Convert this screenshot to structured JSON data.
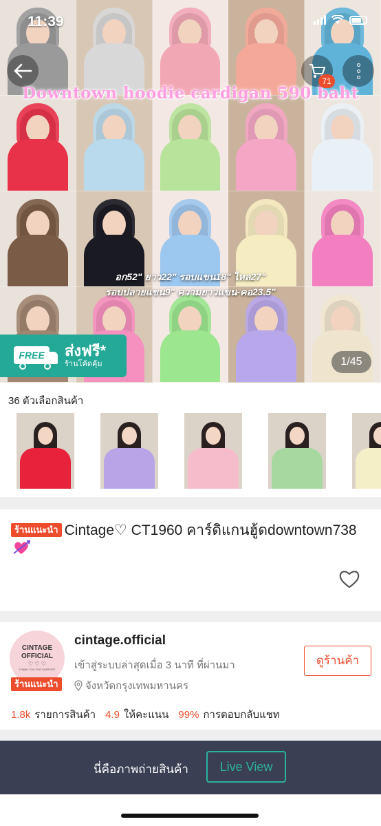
{
  "status_bar": {
    "time": "11:39"
  },
  "hero": {
    "promo_title": "Downtown hoodie cardigan 590 baht",
    "measure_line1": "อก52\" ยาว22\" รอบแขน18\" ไหล27\"",
    "measure_line2": "รอบปลายแขน9\" ความยาวแขน-คอ23.5\"",
    "free_shipping_badge": "FREE",
    "free_shipping_main": "ส่งฟรี*",
    "free_shipping_sub": "ร้านโค้ดคุ้ม",
    "image_counter": "1/45",
    "cart_count": "71",
    "tile_colors": [
      "#9a9a9a",
      "#d8d8d8",
      "#f2a7b5",
      "#f4a89a",
      "#5fb2d8",
      "#e8324a",
      "#b9d9ec",
      "#b8e39a",
      "#f4a6c4",
      "#eaf1f6",
      "#7a5b45",
      "#1a1a22",
      "#9cc7ee",
      "#f6ecc2",
      "#f37fc0",
      "#a08570",
      "#f590bf",
      "#9be68f",
      "#b8a7ea",
      "#efe5cf"
    ]
  },
  "variants": {
    "label": "36 ตัวเลือกสินค้า",
    "thumb_colors": [
      "#e8223a",
      "#b7a5e8",
      "#f6bccc",
      "#a6d8a0",
      "#f5efc8"
    ]
  },
  "product": {
    "recommended_badge": "ร้านแนะนำ",
    "title": "Cintage♡ CT1960 คาร์ดิแกนฮู้ดdowntown738",
    "emoji": "💘"
  },
  "shop": {
    "avatar_line1": "CINTAGE",
    "avatar_line2": "OFFICIAL",
    "avatar_line3": "♡ ♡ ♡",
    "avatar_line4": "THANK YOU FOR SUPPORT",
    "recommended_badge": "ร้านแนะนำ",
    "name": "cintage.official",
    "online_status": "เข้าสู่ระบบล่าสุดเมื่อ 3 นาที ที่ผ่านมา",
    "location": "จังหวัดกรุงเทพมหานคร",
    "visit_button": "ดูร้านค้า",
    "stats": [
      {
        "value": "1.8k",
        "label": "รายการสินค้า"
      },
      {
        "value": "4.9",
        "label": "ให้คะแนน"
      },
      {
        "value": "99%",
        "label": "การตอบกลับแชท"
      }
    ]
  },
  "bottom_bar": {
    "photo_text": "นี่คือภาพถ่ายสินค้า",
    "live_view_button": "Live View"
  },
  "colors": {
    "accent": "#ee4d2d",
    "teal": "#25a997",
    "dark_bar": "#3a3f53"
  }
}
